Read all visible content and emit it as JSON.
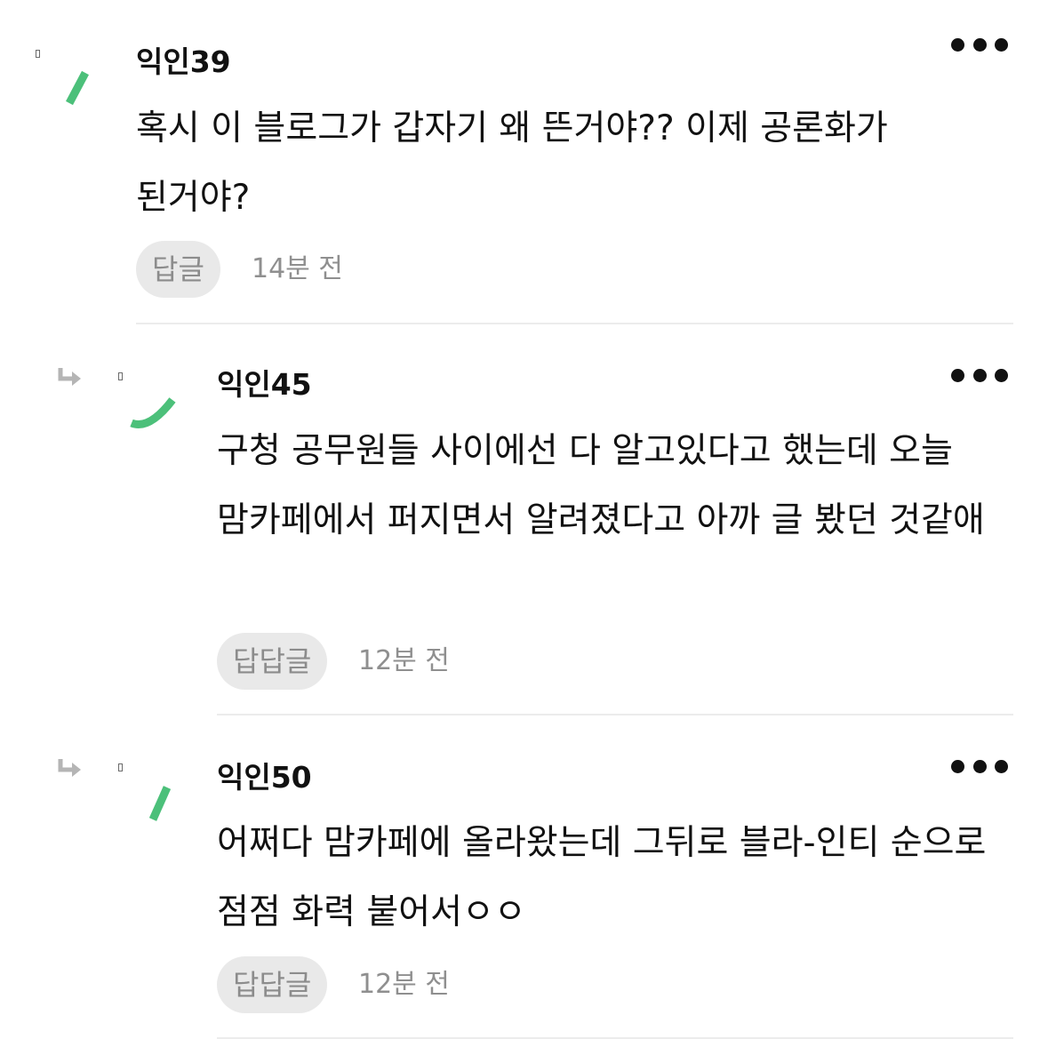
{
  "comments": [
    {
      "author": "익인39",
      "text": "혹시 이 블로그가 갑자기 왜 뜬거야?? 이제 공론화가 된거야?",
      "reply_label": "답글",
      "time": "14분 전",
      "is_reply": false
    },
    {
      "author": "익인45",
      "text": "구청 공무원들 사이에선 다 알고있다고 했는데 오늘 맘카페에서 퍼지면서 알려졌다고 아까 글 봤던 것같애",
      "reply_label": "답답글",
      "time": "12분 전",
      "is_reply": true
    },
    {
      "author": "익인50",
      "text": "어쩌다 맘카페에 올라왔는데 그뒤로 블라-인티 순으로 점점 화력 붙어서ㅇㅇ",
      "reply_label": "답답글",
      "time": "12분 전",
      "is_reply": true
    }
  ],
  "colors": {
    "avatar_accent": "#4cc07a",
    "reply_button_bg": "#e9e9e9",
    "meta_text": "#8f8f8f",
    "divider": "#ececec"
  },
  "icons": {
    "more": "more-dots-icon",
    "reply_arrow": "reply-arrow-icon",
    "avatar": "avatar-icon"
  }
}
